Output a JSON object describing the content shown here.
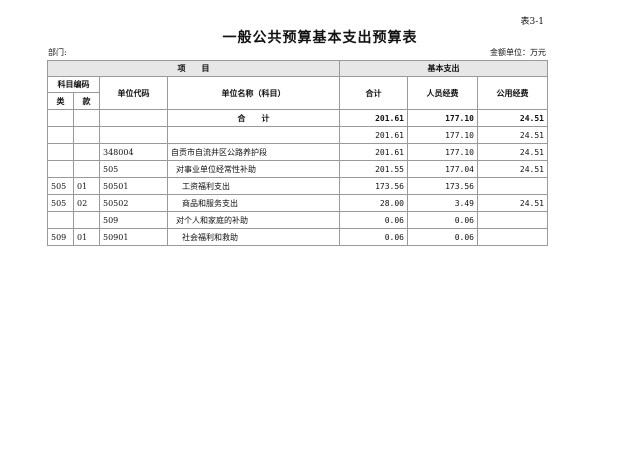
{
  "table_no": "表3-1",
  "title": "一般公共预算基本支出预算表",
  "department_label": "部门:",
  "unit_label": "金额单位：万元",
  "header": {
    "item": "项　　目",
    "basic": "基本支出",
    "subject_code": "科目编码",
    "category": "类",
    "section": "款",
    "unit_code": "单位代码",
    "unit_name": "单位名称（科目）",
    "total": "合计",
    "personnel": "人员经费",
    "public": "公用经费"
  },
  "rows": [
    {
      "lei": "",
      "kuan": "",
      "code": "",
      "name": "合　　计",
      "total": "201.61",
      "personnel": "177.10",
      "public": "24.51"
    },
    {
      "lei": "",
      "kuan": "",
      "code": "",
      "name": "",
      "total": "201.61",
      "personnel": "177.10",
      "public": "24.51"
    },
    {
      "lei": "",
      "kuan": "",
      "code": "348004",
      "name": "自贡市自流井区公路养护段",
      "total": "201.61",
      "personnel": "177.10",
      "public": "24.51"
    },
    {
      "lei": "",
      "kuan": "",
      "code": "505",
      "name": "对事业单位经常性补助",
      "total": "201.55",
      "personnel": "177.04",
      "public": "24.51"
    },
    {
      "lei": "505",
      "kuan": "01",
      "code": "50501",
      "name": "工资福利支出",
      "total": "173.56",
      "personnel": "173.56",
      "public": ""
    },
    {
      "lei": "505",
      "kuan": "02",
      "code": "50502",
      "name": "商品和服务支出",
      "total": "28.00",
      "personnel": "3.49",
      "public": "24.51"
    },
    {
      "lei": "",
      "kuan": "",
      "code": "509",
      "name": "对个人和家庭的补助",
      "total": "0.06",
      "personnel": "0.06",
      "public": ""
    },
    {
      "lei": "509",
      "kuan": "01",
      "code": "50901",
      "name": "社会福利和救助",
      "total": "0.06",
      "personnel": "0.06",
      "public": ""
    }
  ]
}
